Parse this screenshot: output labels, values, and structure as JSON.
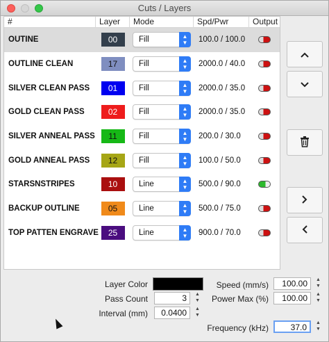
{
  "window": {
    "title": "Cuts / Layers"
  },
  "table": {
    "headers": {
      "name": "#",
      "layer": "Layer",
      "mode": "Mode",
      "speed_power": "Spd/Pwr",
      "output": "Output"
    },
    "rows": [
      {
        "name": "OUTINE",
        "layer": "00",
        "layer_color": "#333f4c",
        "layer_text": "#ffffff",
        "mode": "Fill",
        "speed_power": "100.0 / 100.0",
        "output": "off"
      },
      {
        "name": "OUTLINE CLEAN",
        "layer": "17",
        "layer_color": "#7f8ec0",
        "layer_text": "#111111",
        "mode": "Fill",
        "speed_power": "2000.0 / 40.0",
        "output": "off"
      },
      {
        "name": "SILVER CLEAN PASS",
        "layer": "01",
        "layer_color": "#0000f0",
        "layer_text": "#ffffff",
        "mode": "Fill",
        "speed_power": "2000.0 / 35.0",
        "output": "off"
      },
      {
        "name": "GOLD CLEAN PASS",
        "layer": "02",
        "layer_color": "#ee1c1c",
        "layer_text": "#ffffff",
        "mode": "Fill",
        "speed_power": "2000.0 / 35.0",
        "output": "off"
      },
      {
        "name": "SILVER ANNEAL PASS",
        "layer": "11",
        "layer_color": "#16b816",
        "layer_text": "#111111",
        "mode": "Fill",
        "speed_power": "200.0 / 30.0",
        "output": "off"
      },
      {
        "name": "GOLD ANNEAL PASS",
        "layer": "12",
        "layer_color": "#a6a616",
        "layer_text": "#111111",
        "mode": "Fill",
        "speed_power": "100.0 / 50.0",
        "output": "off"
      },
      {
        "name": "STARSNSTRIPES",
        "layer": "10",
        "layer_color": "#aa0f0f",
        "layer_text": "#ffffff",
        "mode": "Line",
        "speed_power": "500.0 / 90.0",
        "output": "on"
      },
      {
        "name": "BACKUP OUTLINE",
        "layer": "05",
        "layer_color": "#f08a1a",
        "layer_text": "#111111",
        "mode": "Line",
        "speed_power": "500.0 / 75.0",
        "output": "off"
      },
      {
        "name": "TOP PATTEN ENGRAVE",
        "layer": "25",
        "layer_color": "#4a0d7f",
        "layer_text": "#ffffff",
        "mode": "Line",
        "speed_power": "900.0 / 70.0",
        "output": "off"
      }
    ]
  },
  "side_buttons": {
    "up": "chevron-up-icon",
    "down": "chevron-down-icon",
    "delete": "trash-icon",
    "right": "chevron-right-icon",
    "left": "chevron-left-icon"
  },
  "settings": {
    "layer_color_label": "Layer Color",
    "layer_color": "#000000",
    "pass_count_label": "Pass Count",
    "pass_count": "3",
    "interval_label": "Interval (mm)",
    "interval": "0.0400",
    "speed_label": "Speed (mm/s)",
    "speed": "100.00",
    "power_max_label": "Power Max (%)",
    "power_max": "100.00",
    "frequency_label": "Frequency (kHz)",
    "frequency": "37.0"
  },
  "colors": {
    "accent": "#2f7cf6",
    "output_on": "#2db92d",
    "output_off": "#c11111"
  }
}
